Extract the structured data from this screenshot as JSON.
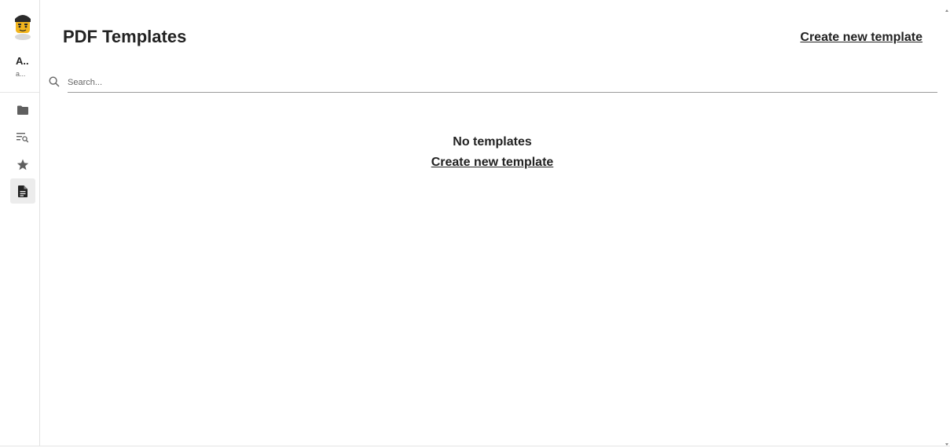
{
  "sidebar": {
    "avatar": "user-avatar-emoji",
    "user_name": "A..",
    "user_email": "a...",
    "items": [
      {
        "icon": "folder-icon",
        "active": false
      },
      {
        "icon": "filter-search-icon",
        "active": false
      },
      {
        "icon": "star-icon",
        "active": false
      },
      {
        "icon": "document-icon",
        "active": true
      }
    ]
  },
  "header": {
    "title": "PDF Templates",
    "create_link": "Create new template"
  },
  "search": {
    "placeholder": "Search...",
    "value": ""
  },
  "empty_state": {
    "title": "No templates",
    "link": "Create new template"
  },
  "colors": {
    "text": "#222222",
    "active_nav_bg": "#ececec",
    "icon": "#5f5f5f"
  }
}
